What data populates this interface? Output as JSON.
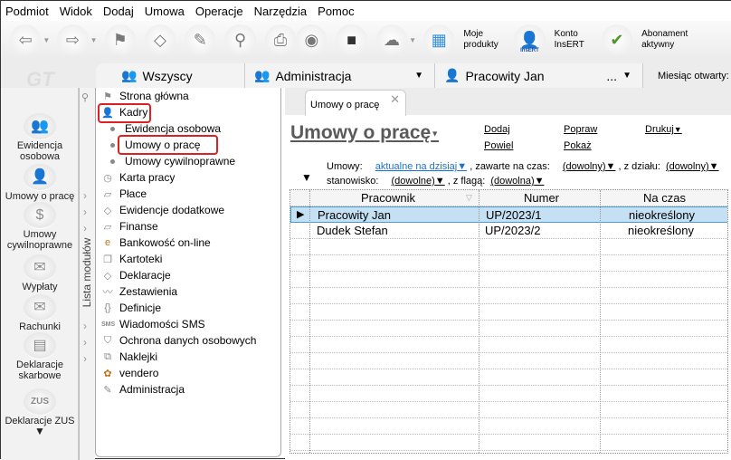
{
  "menu": [
    "Podmiot",
    "Widok",
    "Dodaj",
    "Umowa",
    "Operacje",
    "Narzędzia",
    "Pomoc"
  ],
  "toolbar": {
    "moje_produkty": "Moje produkty",
    "konto": "Konto InsERT",
    "abonament": "Abonament aktywny",
    "insert_badge": "InsERT"
  },
  "tabs": {
    "wszyscy": "Wszyscy",
    "administracja": "Administracja",
    "pracownik": "Pracowity Jan",
    "more": "...",
    "miesiac": "Miesiąc otwarty:"
  },
  "sidebar": {
    "logo": "GT",
    "items": [
      "Ewidencja osobowa",
      "Umowy o pracę",
      "Umowy cywilnoprawne",
      "Wypłaty",
      "Rachunki",
      "Deklaracje skarbowe",
      "Deklaracje ZUS"
    ]
  },
  "module_list_label": "Lista modułów",
  "tree": {
    "items": [
      "Strona główna",
      "Kadry",
      "Ewidencja osobowa",
      "Umowy o pracę",
      "Umowy cywilnoprawne",
      "Karta pracy",
      "Płace",
      "Ewidencje dodatkowe",
      "Finanse",
      "Bankowość on-line",
      "Kartoteki",
      "Deklaracje",
      "Zestawienia",
      "Definicje",
      "Wiadomości SMS",
      "Ochrona danych osobowych",
      "Naklejki",
      "vendero",
      "Administracja"
    ]
  },
  "content": {
    "tab": "Umowy o pracę",
    "title": "Umowy o pracę",
    "actions": {
      "dodaj": "Dodaj",
      "powiel": "Powiel",
      "popraw": "Popraw",
      "pokaz": "Pokaż",
      "drukuj": "Drukuj"
    },
    "filters": {
      "umowy_label": "Umowy:",
      "umowy_value": "aktualne na dzisiaj",
      "zawarte_label": ", zawarte na czas:",
      "zawarte_value": "(dowolny)",
      "dzial_label": ", z działu:",
      "dzial_value": "(dowolny)",
      "stanowisko_label": "stanowisko:",
      "stanowisko_value": "(dowolne)",
      "flaga_label": ", z flagą:",
      "flaga_value": "(dowolna)"
    },
    "grid": {
      "columns": [
        "Pracownik",
        "Numer",
        "Na czas"
      ],
      "rows": [
        {
          "pracownik": "Pracowity Jan",
          "numer": "UP/2023/1",
          "na_czas": "nieokreślony",
          "selected": true
        },
        {
          "pracownik": "Dudek Stefan",
          "numer": "UP/2023/2",
          "na_czas": "nieokreślony",
          "selected": false
        }
      ]
    }
  },
  "colors": {
    "selection": "#c5dff3",
    "highlight_box": "#e02020",
    "link_blue": "#1a73d0"
  }
}
